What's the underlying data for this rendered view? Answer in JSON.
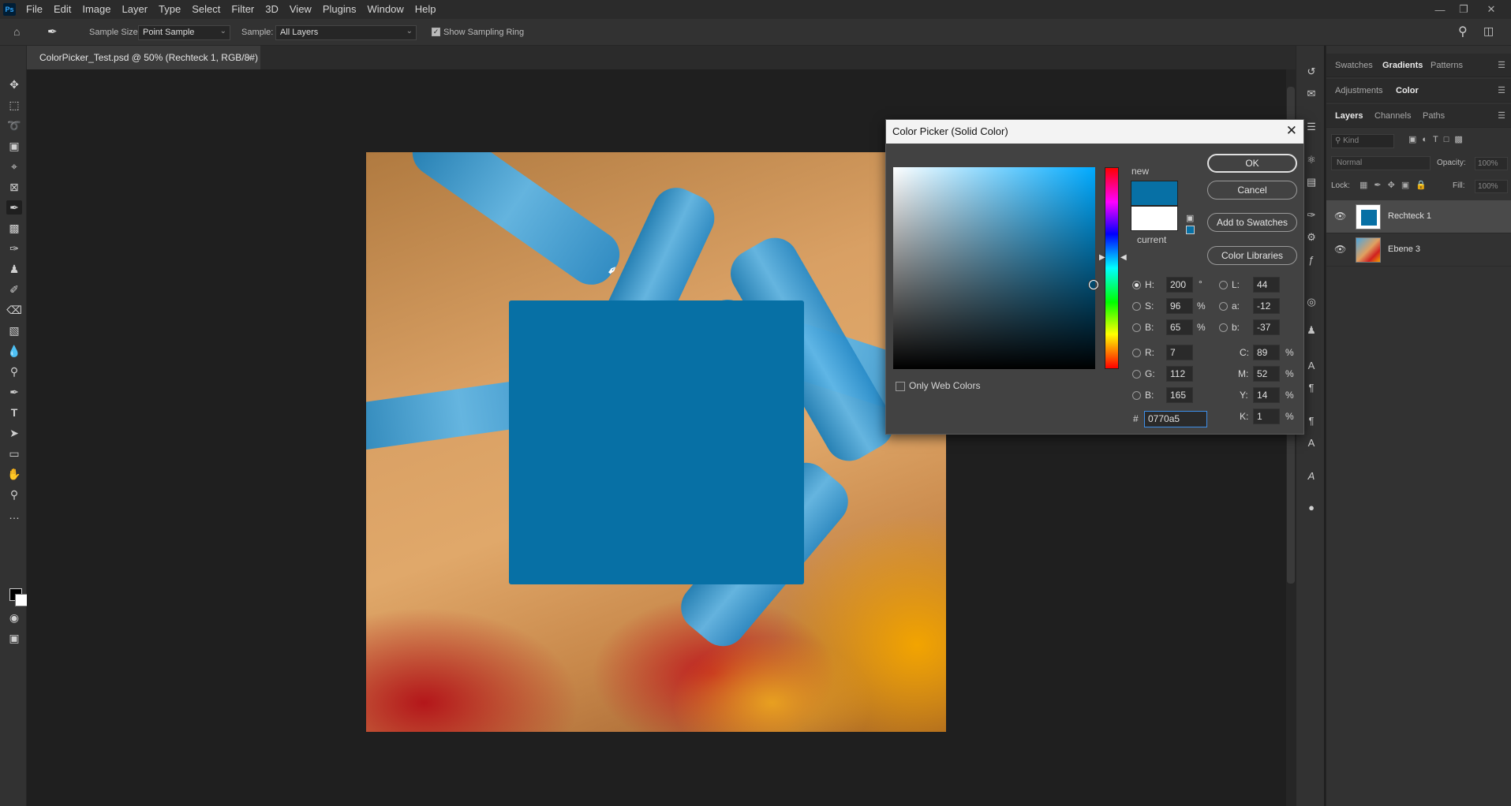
{
  "menu": [
    "File",
    "Edit",
    "Image",
    "Layer",
    "Type",
    "Select",
    "Filter",
    "3D",
    "View",
    "Plugins",
    "Window",
    "Help"
  ],
  "options": {
    "sample_size_label": "Sample Size:",
    "sample_size_value": "Point Sample",
    "sample_label": "Sample:",
    "sample_value": "All Layers",
    "show_ring_label": "Show Sampling Ring"
  },
  "document": {
    "tab_title": "ColorPicker_Test.psd @ 50% (Rechteck 1, RGB/8#)"
  },
  "panels": {
    "top_tabs": [
      "Swatches",
      "Gradients",
      "Patterns"
    ],
    "mid_tabs": [
      "Adjustments",
      "Color"
    ],
    "layer_tabs": [
      "Layers",
      "Channels",
      "Paths"
    ],
    "kind_placeholder": "Kind",
    "blend_mode": "Normal",
    "opacity_label": "Opacity:",
    "opacity_value": "100%",
    "lock_label": "Lock:",
    "fill_label": "Fill:",
    "fill_value": "100%",
    "layers": [
      {
        "name": "Rechteck 1"
      },
      {
        "name": "Ebene 3"
      }
    ]
  },
  "dialog": {
    "title": "Color Picker (Solid Color)",
    "new_label": "new",
    "current_label": "current",
    "new_color": "#0770a5",
    "current_color": "#ffffff",
    "buttons": {
      "ok": "OK",
      "cancel": "Cancel",
      "add_swatches": "Add to Swatches",
      "libraries": "Color Libraries"
    },
    "only_web_colors": "Only Web Colors",
    "hsb": {
      "h_label": "H:",
      "h": "200",
      "h_unit": "°",
      "s_label": "S:",
      "s": "96",
      "s_unit": "%",
      "b_label": "B:",
      "b": "65",
      "b_unit": "%"
    },
    "lab": {
      "l_label": "L:",
      "l": "44",
      "a_label": "a:",
      "a": "-12",
      "b_label": "b:",
      "b": "-37"
    },
    "rgb": {
      "r_label": "R:",
      "r": "7",
      "g_label": "G:",
      "g": "112",
      "b_label": "B:",
      "b": "165"
    },
    "cmyk": {
      "c_label": "C:",
      "c": "89",
      "m_label": "M:",
      "m": "52",
      "y_label": "Y:",
      "y": "14",
      "k_label": "K:",
      "k": "1",
      "unit": "%"
    },
    "hex_label": "#",
    "hex": "0770a5"
  }
}
